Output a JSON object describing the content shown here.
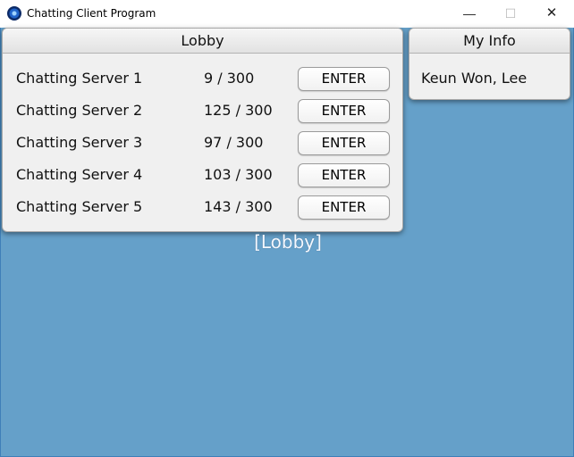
{
  "window": {
    "title": "Chatting Client Program",
    "icon": "app-orb-icon",
    "controls": {
      "minimize": "—",
      "maximize": "☐",
      "close": "✕"
    }
  },
  "lobby": {
    "header": "Lobby",
    "servers": [
      {
        "name": "Chatting Server 1",
        "count": "9 / 300",
        "button": "ENTER"
      },
      {
        "name": "Chatting Server 2",
        "count": "125 / 300",
        "button": "ENTER"
      },
      {
        "name": "Chatting Server 3",
        "count": "97 / 300",
        "button": "ENTER"
      },
      {
        "name": "Chatting Server 4",
        "count": "103 / 300",
        "button": "ENTER"
      },
      {
        "name": "Chatting Server 5",
        "count": "143 / 300",
        "button": "ENTER"
      }
    ]
  },
  "my_info": {
    "header": "My Info",
    "user_name": "Keun Won, Lee"
  },
  "scene_label": "[Lobby]",
  "colors": {
    "background": "#65a0c9",
    "panel": "#f0f0f0"
  }
}
